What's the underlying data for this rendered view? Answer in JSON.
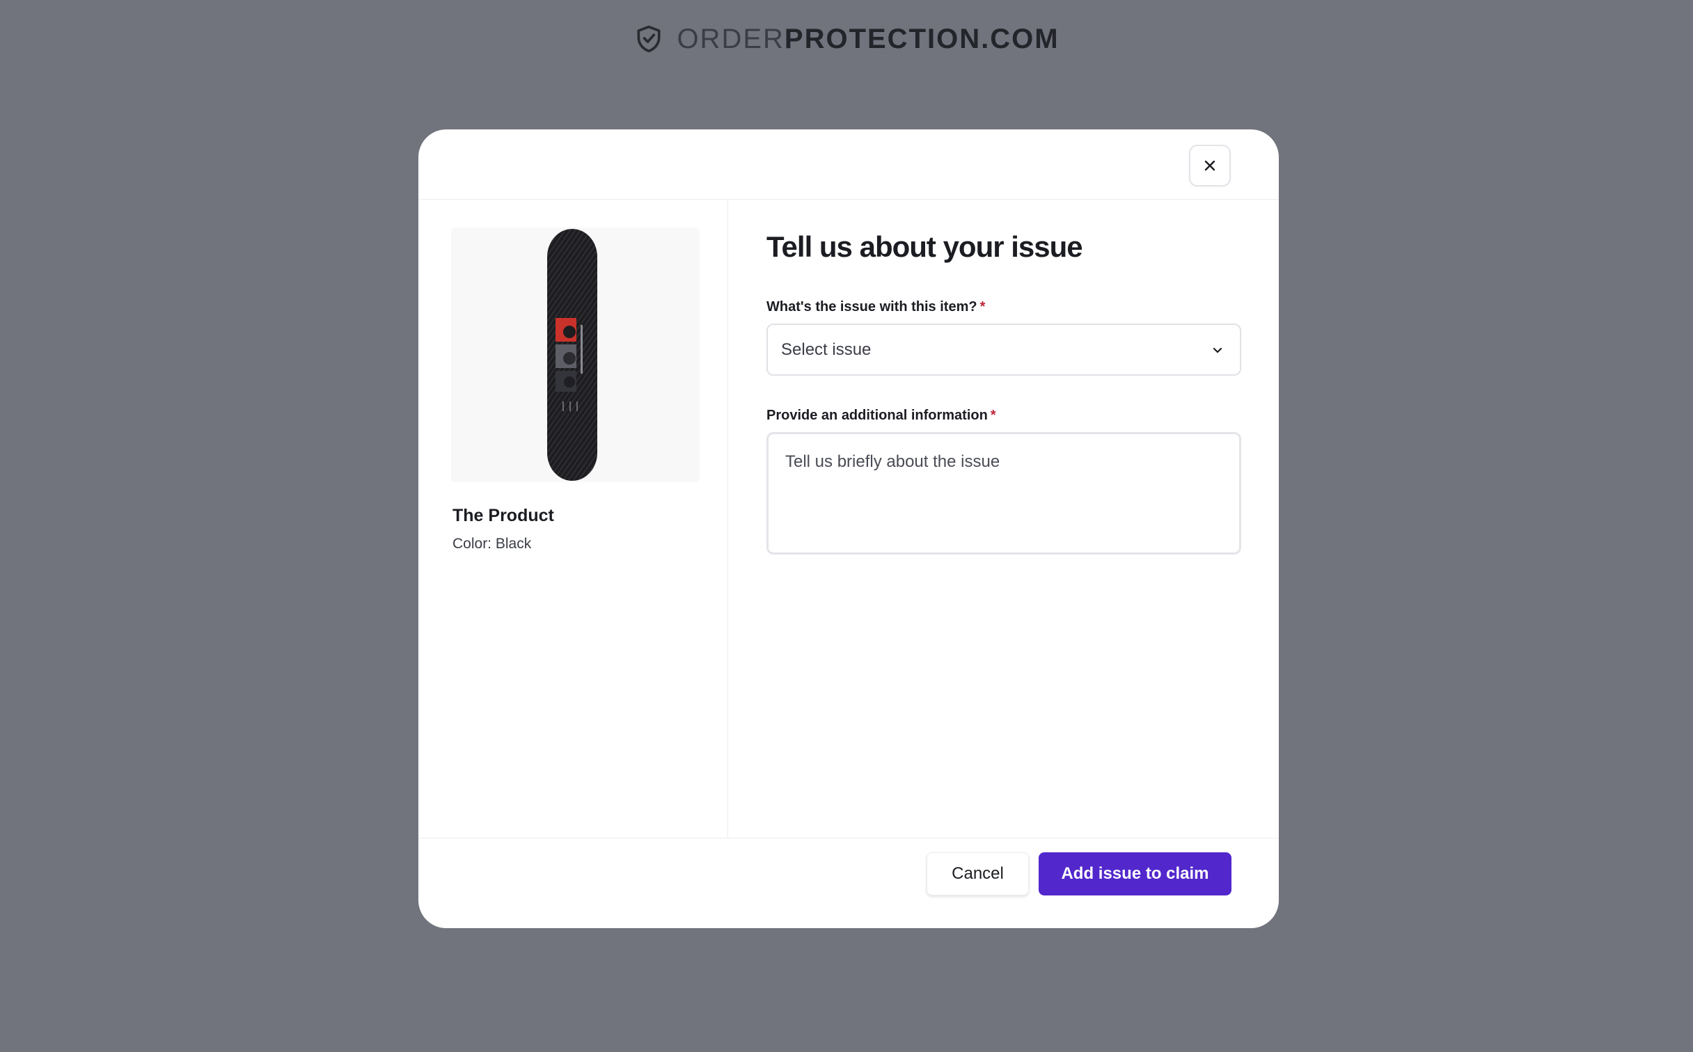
{
  "brand": {
    "logo_icon": "shield-check-icon",
    "name_light": "ORDER",
    "name_bold": "PROTECTION.COM"
  },
  "modal": {
    "close_icon": "close-icon",
    "product": {
      "name": "The Product",
      "color": "Color: Black"
    },
    "title": "Tell us about your issue",
    "issue_field": {
      "label": "What's the issue with this item?",
      "required_mark": "*",
      "placeholder": "Select issue",
      "icon": "chevron-down-icon"
    },
    "info_field": {
      "label": "Provide an additional information",
      "required_mark": "*",
      "placeholder": "Tell us briefly about the issue"
    },
    "footer": {
      "cancel_label": "Cancel",
      "submit_label": "Add issue to claim"
    }
  },
  "colors": {
    "backdrop": "#71737d",
    "primary": "#5227cc",
    "required": "#c0263a"
  }
}
